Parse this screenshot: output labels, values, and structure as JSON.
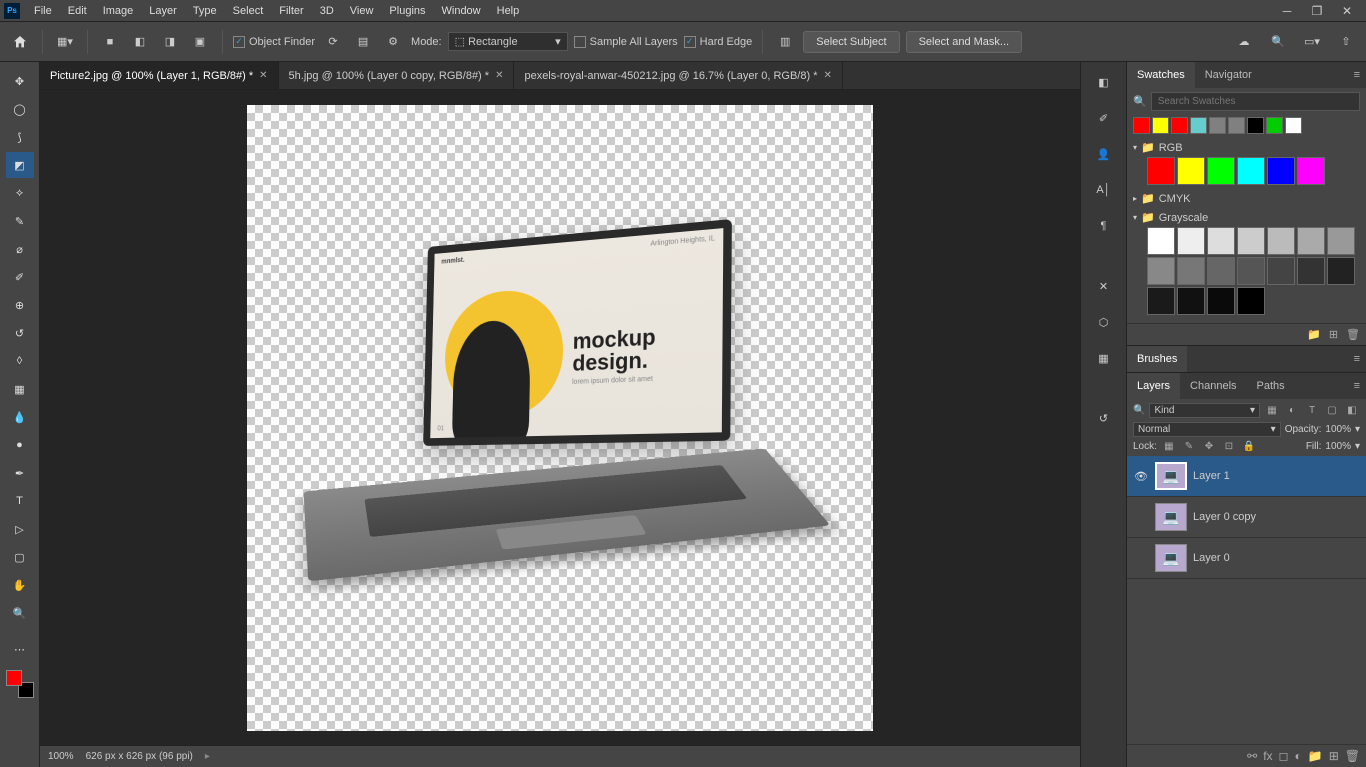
{
  "menubar": {
    "logo": "Ps",
    "items": [
      "File",
      "Edit",
      "Image",
      "Layer",
      "Type",
      "Select",
      "Filter",
      "3D",
      "View",
      "Plugins",
      "Window",
      "Help"
    ]
  },
  "options": {
    "object_finder": "Object Finder",
    "mode_label": "Mode:",
    "mode_value": "Rectangle",
    "sample_all": "Sample All Layers",
    "hard_edge": "Hard Edge",
    "select_subject": "Select Subject",
    "select_mask": "Select and Mask..."
  },
  "tabs": [
    {
      "label": "Picture2.jpg @ 100% (Layer 1, RGB/8#) *",
      "active": true
    },
    {
      "label": "5h.jpg @ 100% (Layer 0 copy, RGB/8#) *",
      "active": false
    },
    {
      "label": "pexels-royal-anwar-450212.jpg @ 16.7% (Layer 0, RGB/8) *",
      "active": false
    }
  ],
  "canvas": {
    "mockup_brand": "mnmlst.",
    "mockup_title1": "mockup",
    "mockup_title2": "design.",
    "mockup_lorem": "lorem ipsum dolor sit amet",
    "mockup_corner_tr": "Arlington Heights, IL",
    "mockup_corner_bl": "01"
  },
  "statusbar": {
    "zoom": "100%",
    "docinfo": "626 px x 626 px (96 ppi)"
  },
  "swatches": {
    "tab1": "Swatches",
    "tab2": "Navigator",
    "search_placeholder": "Search Swatches",
    "top_colors": [
      "#ff0000",
      "#ffff00",
      "#ff0000",
      "#66cccc",
      "#808080",
      "#808080",
      "#000000",
      "#00cc00",
      "#ffffff"
    ],
    "group_rgb": "RGB",
    "rgb_colors": [
      "#ff0000",
      "#ffff00",
      "#00ff00",
      "#00ffff",
      "#0000ff",
      "#ff00ff"
    ],
    "group_cmyk": "CMYK",
    "group_gray": "Grayscale",
    "gray_colors": [
      "#ffffff",
      "#eeeeee",
      "#dddddd",
      "#cccccc",
      "#bbbbbb",
      "#aaaaaa",
      "#999999",
      "#888888",
      "#777777",
      "#666666",
      "#555555",
      "#444444",
      "#333333",
      "#222222",
      "#1a1a1a",
      "#111111",
      "#0a0a0a",
      "#000000"
    ]
  },
  "brushes": {
    "tab": "Brushes"
  },
  "layers": {
    "tab1": "Layers",
    "tab2": "Channels",
    "tab3": "Paths",
    "kind": "Kind",
    "blend": "Normal",
    "opacity_label": "Opacity:",
    "opacity": "100%",
    "lock_label": "Lock:",
    "fill_label": "Fill:",
    "fill": "100%",
    "items": [
      {
        "name": "Layer 1",
        "visible": true,
        "active": true
      },
      {
        "name": "Layer 0 copy",
        "visible": false,
        "active": false
      },
      {
        "name": "Layer 0",
        "visible": false,
        "active": false
      }
    ]
  }
}
